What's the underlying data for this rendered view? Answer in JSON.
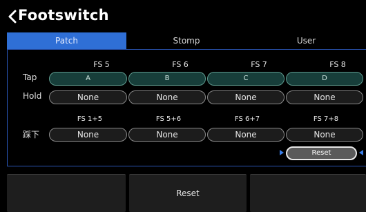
{
  "header": {
    "title": "Footswitch",
    "back_icon": "chevron-left-icon"
  },
  "tabs": [
    {
      "label": "Patch",
      "active": true
    },
    {
      "label": "Stomp",
      "active": false
    },
    {
      "label": "User",
      "active": false
    }
  ],
  "grid": {
    "columns": [
      "FS 5",
      "FS 6",
      "FS 7",
      "FS 8"
    ],
    "tap_label": "Tap",
    "tap_values": [
      "A",
      "B",
      "C",
      "D"
    ],
    "hold_label": "Hold",
    "hold_values": [
      "None",
      "None",
      "None",
      "None"
    ],
    "combo_columns": [
      "FS 1+5",
      "FS 5+6",
      "FS 6+7",
      "FS 7+8"
    ],
    "press_label": "踩下",
    "press_values": [
      "None",
      "None",
      "None",
      "None"
    ]
  },
  "reset_pill": {
    "label": "Reset"
  },
  "bottom_bar": {
    "left_label": "",
    "center_label": "Reset",
    "right_label": ""
  },
  "colors": {
    "accent": "#2f6fd6",
    "tap_fill": "#173e3a",
    "tap_border": "#5e9a8e",
    "panel_border": "#2b57b8"
  }
}
